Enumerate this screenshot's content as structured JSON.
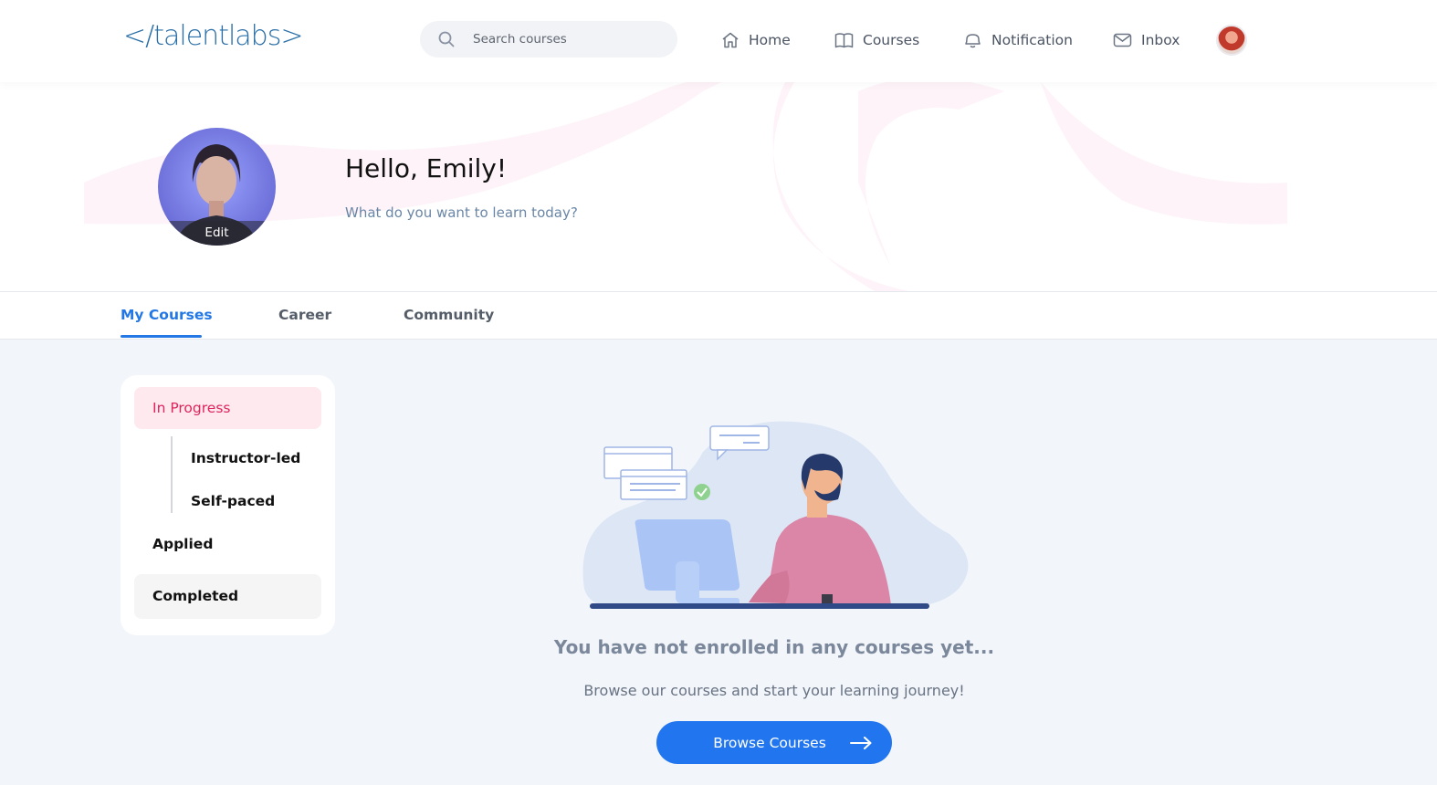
{
  "header": {
    "logo": "</talentlabs>",
    "search": {
      "placeholder": "Search courses"
    },
    "nav": [
      {
        "label": "Home",
        "icon": "home-icon"
      },
      {
        "label": "Courses",
        "icon": "book-icon"
      },
      {
        "label": "Notification",
        "icon": "bell-icon"
      },
      {
        "label": "Inbox",
        "icon": "mail-icon"
      }
    ]
  },
  "hero": {
    "greeting": "Hello, Emily!",
    "subtitle": "What do you want to learn today?",
    "edit_label": "Edit"
  },
  "tabs": [
    {
      "label": "My Courses",
      "active": true
    },
    {
      "label": "Career",
      "active": false
    },
    {
      "label": "Community",
      "active": false
    }
  ],
  "sidebar": {
    "items": [
      {
        "label": "In Progress",
        "active": true
      },
      {
        "label": "Instructor-led"
      },
      {
        "label": "Self-paced"
      },
      {
        "label": "Applied"
      },
      {
        "label": "Completed"
      }
    ]
  },
  "empty_state": {
    "title": "You have not enrolled in any courses yet...",
    "subtitle": "Browse our courses and start your learning journey!",
    "button_label": "Browse Courses"
  },
  "colors": {
    "accent": "#2176f0",
    "active_pink": "#e0245e",
    "logo_blue": "#2a6fa8"
  }
}
